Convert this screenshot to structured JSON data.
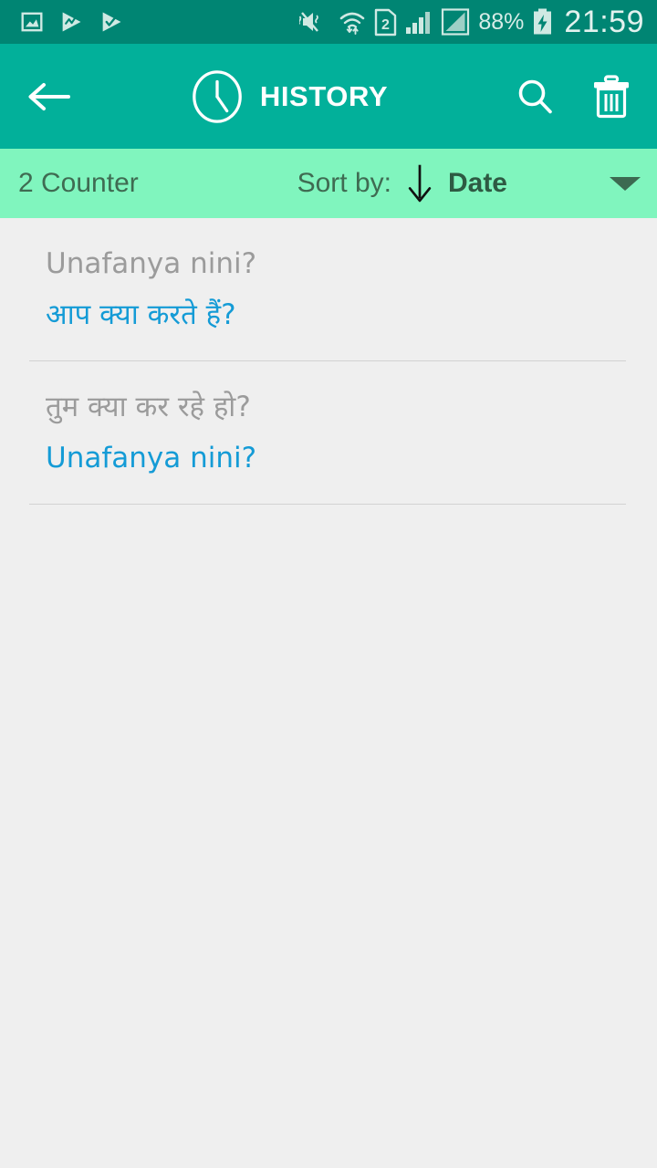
{
  "status_bar": {
    "left_icons": [
      "gallery-image-icon",
      "play-stats-icon",
      "play-check-icon"
    ],
    "right_icons": [
      "mute-vibrate-icon",
      "wifi-transfer-icon",
      "sim-2-icon",
      "signal-bars-icon",
      "signal-triangle-icon"
    ],
    "sim_label": "2",
    "battery_percent": "88%",
    "battery_state": "charging",
    "time": "21:59",
    "background_color": "#008573"
  },
  "app_bar": {
    "back_icon": "arrow-left-icon",
    "title_icon": "clock-icon",
    "title": "HISTORY",
    "search_icon": "search-icon",
    "delete_icon": "trash-icon",
    "background_color": "#02b09a",
    "text_color": "#ffffff"
  },
  "sort_bar": {
    "counter_label": "2 Counter",
    "sort_by_label": "Sort by:",
    "sort_direction_icon": "arrow-down-icon",
    "sort_value": "Date",
    "caret_icon": "chevron-down-icon",
    "background_color": "#80f5be",
    "text_color": "#3f6b52"
  },
  "history": {
    "items": [
      {
        "source": "Unafanya nini?",
        "target": "आप क्या करते हैं?",
        "source_script": "latin",
        "target_script": "devanagari"
      },
      {
        "source": "तुम क्या कर रहे हो?",
        "target": "Unafanya nini?",
        "source_script": "devanagari",
        "target_script": "latin"
      }
    ],
    "source_color": "#9b9b9b",
    "target_color": "#149bd6",
    "background_color": "#efefef"
  }
}
